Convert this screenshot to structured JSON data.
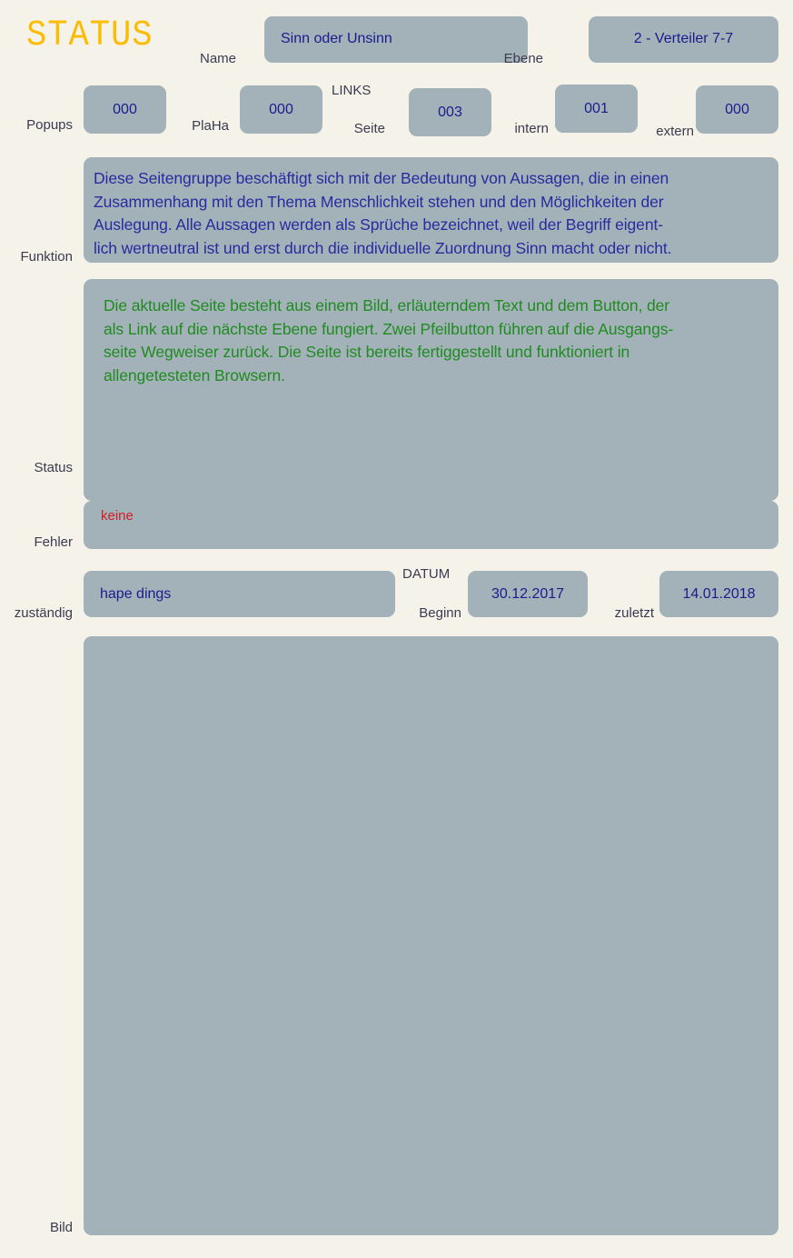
{
  "app": {
    "title": "STATUS",
    "title_color": "#fbbc05",
    "background_color": "#f5f2ea",
    "panel_color": "#a3b2b8",
    "label_color": "#3b3b4f",
    "value_color": "#1b1b8e"
  },
  "header": {
    "name": {
      "label": "Name",
      "value": "Sinn oder Unsinn"
    },
    "ebene": {
      "label": "Ebene",
      "value": "2 - Verteiler 7-7"
    }
  },
  "counters": {
    "links_group_label": "LINKS",
    "items": [
      {
        "label": "Popups",
        "value": "000"
      },
      {
        "label": "PlaHa",
        "value": "000"
      },
      {
        "label": "Seite",
        "value": "003"
      },
      {
        "label": "intern",
        "value": "001"
      },
      {
        "label": "extern",
        "value": "000"
      }
    ]
  },
  "funktion": {
    "label": "Funktion",
    "text": "Diese Seitengruppe beschäftigt sich mit der Bedeutung von Aussagen, die in einen\nZusammenhang mit den Thema Menschlichkeit stehen und den Möglichkeiten der\nAuslegung. Alle Aussagen werden als Sprüche bezeichnet, weil der Begriff eigent-\nlich wertneutral ist und erst durch die individuelle Zuordnung Sinn macht oder nicht.",
    "text_color": "#2a2aa0"
  },
  "status": {
    "label": "Status",
    "text": "Die aktuelle Seite besteht aus einem Bild, erläuterndem Text und dem Button, der\nals Link auf die nächste Ebene fungiert. Zwei Pfeilbutton führen auf die Ausgangs-\nseite Wegweiser zurück. Die Seite ist bereits fertiggestellt und funktioniert in\nallengetesteten Browsern.",
    "text_color": "#1f8b21"
  },
  "fehler": {
    "label": "Fehler",
    "text": "keine",
    "text_color": "#cf2026"
  },
  "footer": {
    "zustaendig": {
      "label": "zuständig",
      "value": "hape dings"
    },
    "datum_group_label": "DATUM",
    "beginn": {
      "label": "Beginn",
      "value": "30.12.2017"
    },
    "zuletzt": {
      "label": "zuletzt",
      "value": "14.01.2018"
    }
  },
  "bild": {
    "label": "Bild",
    "value": ""
  }
}
